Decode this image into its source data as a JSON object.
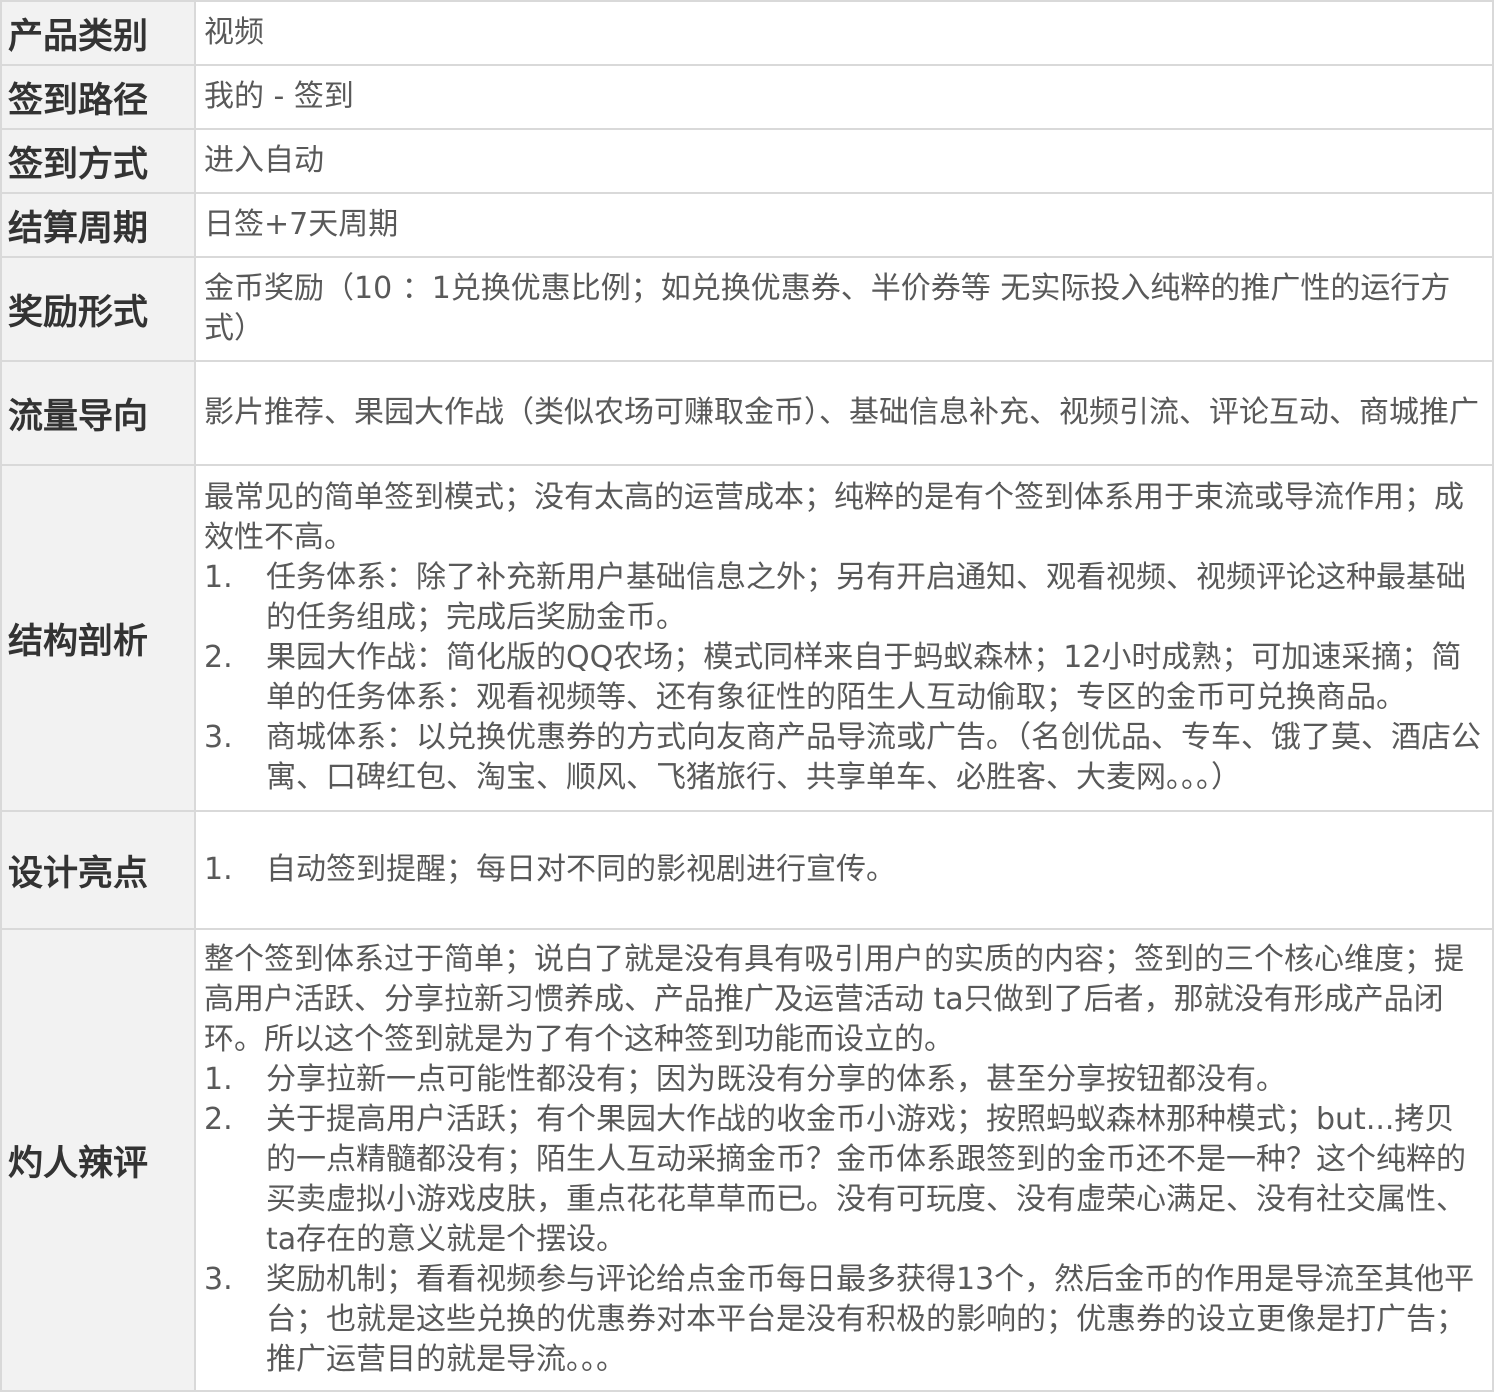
{
  "rows": [
    {
      "label": "产品类别",
      "text": "视频"
    },
    {
      "label": "签到路径",
      "text": "我的 - 签到"
    },
    {
      "label": "签到方式",
      "text": "进入自动"
    },
    {
      "label": "结算周期",
      "text": "日签+7天周期"
    },
    {
      "label": "奖励形式",
      "text": "金币奖励（10 ：1兑换优惠比例；如兑换优惠券、半价券等 无实际投入纯粹的推广性的运行方式）"
    },
    {
      "label": "流量导向",
      "text": "影片推荐、果园大作战（类似农场可赚取金币）、基础信息补充、视频引流、评论互动、商城推广"
    },
    {
      "label": "结构剖析",
      "intro": "最常见的简单签到模式；没有太高的运营成本；纯粹的是有个签到体系用于束流或导流作用；成效性不高。",
      "items": [
        {
          "num": "1.",
          "text": " 任务体系：除了补充新用户基础信息之外；另有开启通知、观看视频、视频评论这种最基础的任务组成；完成后奖励金币。"
        },
        {
          "num": "2.",
          "text": "果园大作战：简化版的QQ农场；模式同样来自于蚂蚁森林；12小时成熟；可加速采摘；简单的任务体系：观看视频等、还有象征性的陌生人互动偷取；专区的金币可兑换商品。"
        },
        {
          "num": "3.",
          "text": "商城体系：以兑换优惠券的方式向友商产品导流或广告。（名创优品、专车、饿了莫、酒店公寓、口碑红包、淘宝、顺风、飞猪旅行、共享单车、必胜客、大麦网。。。）"
        }
      ]
    },
    {
      "label": "设计亮点",
      "items": [
        {
          "num": "1.",
          "text": "自动签到提醒；每日对不同的影视剧进行宣传。"
        }
      ]
    },
    {
      "label": "灼人辣评",
      "intro": "整个签到体系过于简单；说白了就是没有具有吸引用户的实质的内容；签到的三个核心维度；提高用户活跃、分享拉新习惯养成、产品推广及运营活动 ta只做到了后者，那就没有形成产品闭环。所以这个签到就是为了有个这种签到功能而设立的。",
      "items": [
        {
          "num": "1.",
          "text": "分享拉新一点可能性都没有；因为既没有分享的体系，甚至分享按钮都没有。"
        },
        {
          "num": "2.",
          "text": "关于提高用户活跃；有个果园大作战的收金币小游戏；按照蚂蚁森林那种模式；but...拷贝的一点精髓都没有；陌生人互动采摘金币？金币体系跟签到的金币还不是一种？这个纯粹的买卖虚拟小游戏皮肤，重点花花草草而已。没有可玩度、没有虚荣心满足、没有社交属性、ta存在的意义就是个摆设。"
        },
        {
          "num": "3.",
          "text": "奖励机制；看看视频参与评论给点金币每日最多获得13个，然后金币的作用是导流至其他平台；也就是这些兑换的优惠券对本平台是没有积极的影响的；优惠券的设立更像是打广告；推广运营目的就是导流。。。"
        }
      ]
    }
  ]
}
